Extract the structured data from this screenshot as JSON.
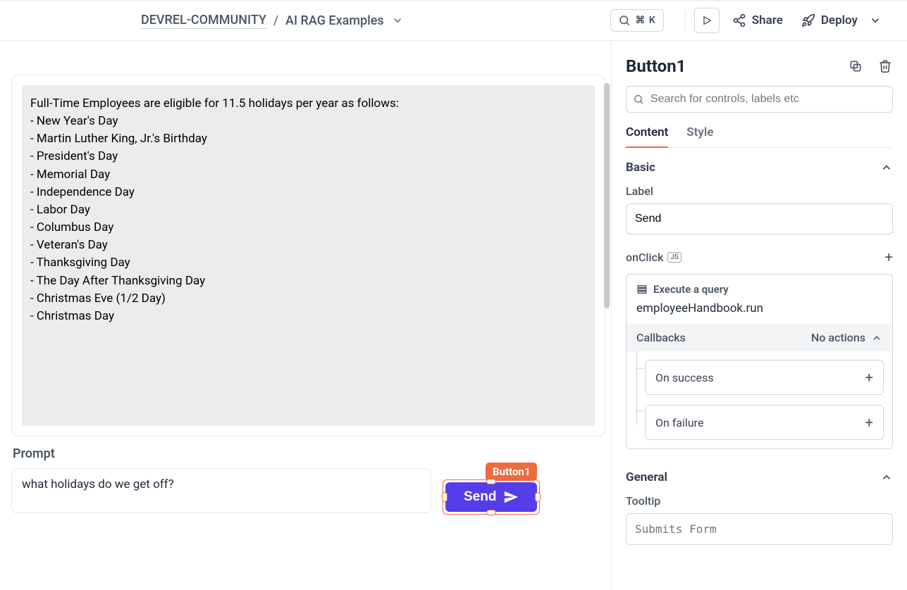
{
  "header": {
    "breadcrumb_project": "DEVREL-COMMUNITY",
    "breadcrumb_page": "AI RAG Examples",
    "cmdk_shortcut": "⌘ K",
    "share_label": "Share",
    "deploy_label": "Deploy"
  },
  "canvas": {
    "output_text": "Full-Time Employees are eligible for 11.5 holidays per year as follows:\n- New Year's Day\n- Martin Luther King, Jr.'s Birthday\n- President's Day\n- Memorial Day\n- Independence Day\n- Labor Day\n- Columbus Day\n- Veteran's Day\n- Thanksgiving Day\n- The Day After Thanksgiving Day\n- Christmas Eve (1/2 Day)\n- Christmas Day",
    "prompt_label": "Prompt",
    "prompt_value": "what holidays do we get off?",
    "send_button_label": "Send",
    "selection_tag": "Button1"
  },
  "panel": {
    "title": "Button1",
    "search_placeholder": "Search for controls, labels etc",
    "tabs": {
      "content": "Content",
      "style": "Style",
      "active": "content"
    },
    "sections": {
      "basic": {
        "title": "Basic",
        "label_field_label": "Label",
        "label_value": "Send",
        "onclick_label": "onClick",
        "js_badge": "JS",
        "action_title": "Execute a query",
        "action_query": "employeeHandbook.run",
        "callbacks_label": "Callbacks",
        "callbacks_status": "No actions",
        "on_success": "On success",
        "on_failure": "On failure"
      },
      "general": {
        "title": "General",
        "tooltip_label": "Tooltip",
        "tooltip_placeholder": "Submits Form"
      }
    }
  }
}
